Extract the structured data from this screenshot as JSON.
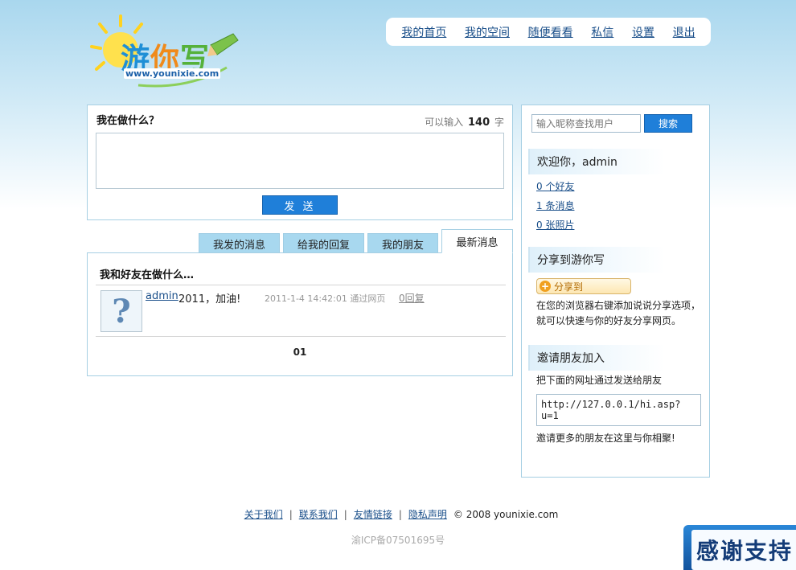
{
  "logo": {
    "chars": [
      "游",
      "你",
      "写"
    ],
    "url": "www.younixie.com"
  },
  "nav": {
    "items": [
      "我的首页",
      "我的空间",
      "随便看看",
      "私信",
      "设置",
      "退出"
    ]
  },
  "post": {
    "title": "我在做什么？",
    "limit_prefix": "可以输入",
    "limit_count": "140",
    "limit_suffix": "字",
    "textarea_value": "",
    "send_label": "发 送"
  },
  "tabs": [
    {
      "label": "我发的消息",
      "active": false
    },
    {
      "label": "给我的回复",
      "active": false
    },
    {
      "label": "我的朋友",
      "active": false
    },
    {
      "label": "最新消息",
      "active": true
    }
  ],
  "feed": {
    "title": "我和好友在做什么…",
    "items": [
      {
        "user": "admin",
        "text": "2011，加油!",
        "time": "2011-1-4 14:42:01",
        "via": "通过网页",
        "reply": "0回复"
      }
    ],
    "pager": "01"
  },
  "sidebar": {
    "search_placeholder": "输入昵称查找用户",
    "search_button": "搜索",
    "welcome": {
      "title": "欢迎你，admin",
      "links": [
        "0 个好友",
        "1 条消息",
        "0 张照片"
      ]
    },
    "share": {
      "title": "分享到游你写",
      "button": "分享到",
      "desc": "在您的浏览器右键添加说说分享选项，就可以快速与你的好友分享网页。"
    },
    "invite": {
      "title": "邀请朋友加入",
      "desc": "把下面的网址通过发送给朋友",
      "url": "http://127.0.0.1/hi.asp?u=1",
      "footer": "邀请更多的朋友在这里与你相聚!"
    }
  },
  "footer": {
    "links": [
      "关于我们",
      "联系我们",
      "友情链接",
      "隐私声明"
    ],
    "copyright": "© 2008 younixie.com",
    "icp": "渝ICP备07501695号"
  },
  "badge": {
    "text": "感谢支持"
  }
}
